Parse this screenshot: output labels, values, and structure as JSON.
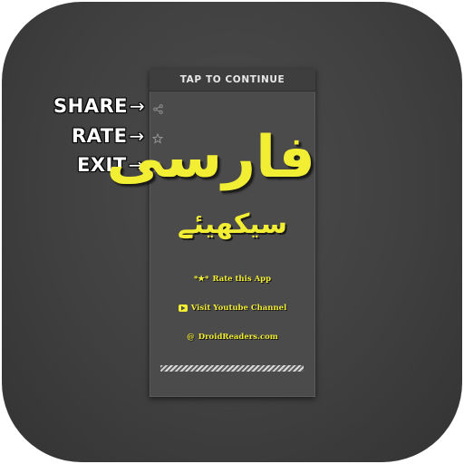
{
  "annotations": {
    "share": {
      "label": "SHARE",
      "arrow": "→"
    },
    "rate": {
      "label": "RATE",
      "arrow": "→"
    },
    "exit": {
      "label": "EXIT",
      "arrow": "→"
    }
  },
  "screen": {
    "header": "TAP TO CONTINUE",
    "title": "فارسی",
    "subtitle": "سیکھیئے",
    "links": {
      "rate": {
        "prefix": "*★*",
        "label": "Rate this App"
      },
      "youtube": {
        "label": "Visit Youtube Channel",
        "icon": "youtube-icon"
      },
      "site": {
        "prefix": "@",
        "label": "DroidReaders.com"
      }
    },
    "side_icons": [
      "share-icon",
      "star-icon",
      "exit-icon"
    ]
  },
  "colors": {
    "accent": "#f2ee34",
    "panel": "#4b4b4b",
    "header": "#3e3e3e",
    "tile": "#404040"
  }
}
